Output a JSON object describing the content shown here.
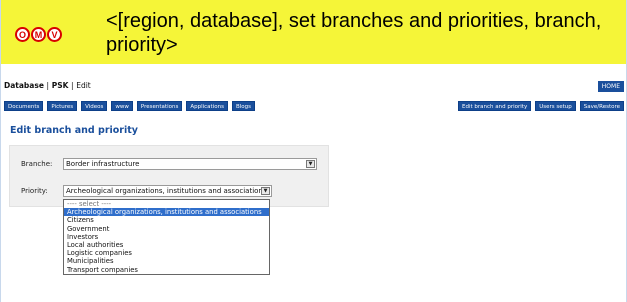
{
  "banner": {
    "logo_letters": [
      "O",
      "M",
      "V"
    ],
    "logo_color": "#d80000",
    "background": "#f5f538",
    "title": "<[region, database], set branches and priorities, branch, priority>"
  },
  "breadcrumb": {
    "root": "Database",
    "sep1": "|",
    "section": "PSK",
    "sep2": "|",
    "current": "Edit"
  },
  "home_label": "HOME",
  "nav_left": [
    "Documents",
    "Pictures",
    "Videos",
    "www",
    "Presentations",
    "Applications",
    "Blogs"
  ],
  "nav_right": [
    "Edit branch and priority",
    "Users setup",
    "Save/Restore"
  ],
  "page_title": "Edit branch and priority",
  "form": {
    "branch_label": "Branche:",
    "branch_value": "Border infrastructure",
    "priority_label": "Priority:",
    "priority_value": "Archeological organizations, institutions and associations"
  },
  "priority_options": [
    "---- select ----",
    "Archeological organizations, institutions and associations",
    "Citizens",
    "Government",
    "Investors",
    "Local authorities",
    "Logistic companies",
    "Municipalities",
    "Transport companies"
  ],
  "selected_option_index": 1,
  "accent_color": "#1a4f9c"
}
